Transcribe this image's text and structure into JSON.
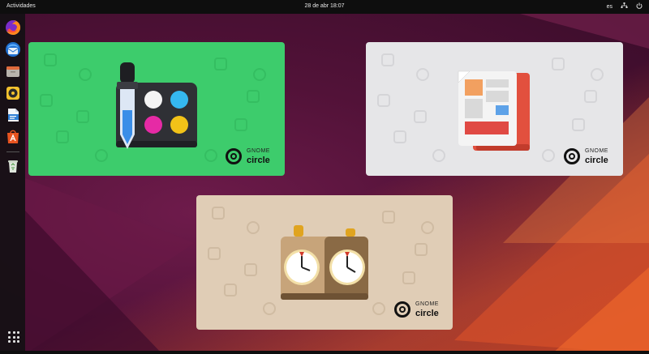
{
  "topbar": {
    "activities": "Actividades",
    "datetime": "28 de abr  18:07",
    "keyboard_layout": "es",
    "network_icon": "network-icon",
    "power_icon": "power-icon"
  },
  "dock": {
    "items": [
      {
        "name": "firefox",
        "icon": "firefox-icon",
        "running": false
      },
      {
        "name": "thunderbird",
        "icon": "thunderbird-icon",
        "running": false
      },
      {
        "name": "files",
        "icon": "files-icon",
        "running": false
      },
      {
        "name": "rhythmbox",
        "icon": "rhythmbox-icon",
        "running": false
      },
      {
        "name": "libreoffice-writer",
        "icon": "writer-icon",
        "running": false
      },
      {
        "name": "app-center",
        "icon": "app-center-icon",
        "running": false
      },
      {
        "name": "trash",
        "icon": "trash-icon",
        "running": false
      }
    ],
    "show_apps_icon": "apps-grid-icon"
  },
  "windows": [
    {
      "name": "color-picker",
      "badge_line1": "GNOME",
      "badge_line2": "circle",
      "color": "#3dcc6c"
    },
    {
      "name": "document-viewer",
      "badge_line1": "GNOME",
      "badge_line2": "circle",
      "color": "#e6e6e8"
    },
    {
      "name": "chess-clock",
      "badge_line1": "GNOME",
      "badge_line2": "circle",
      "color": "#e0cdb6"
    }
  ],
  "colors": {
    "topbar": "#0e0e0e",
    "wallpaper_primary": "#5a1440",
    "wallpaper_accent": "#e95420"
  }
}
